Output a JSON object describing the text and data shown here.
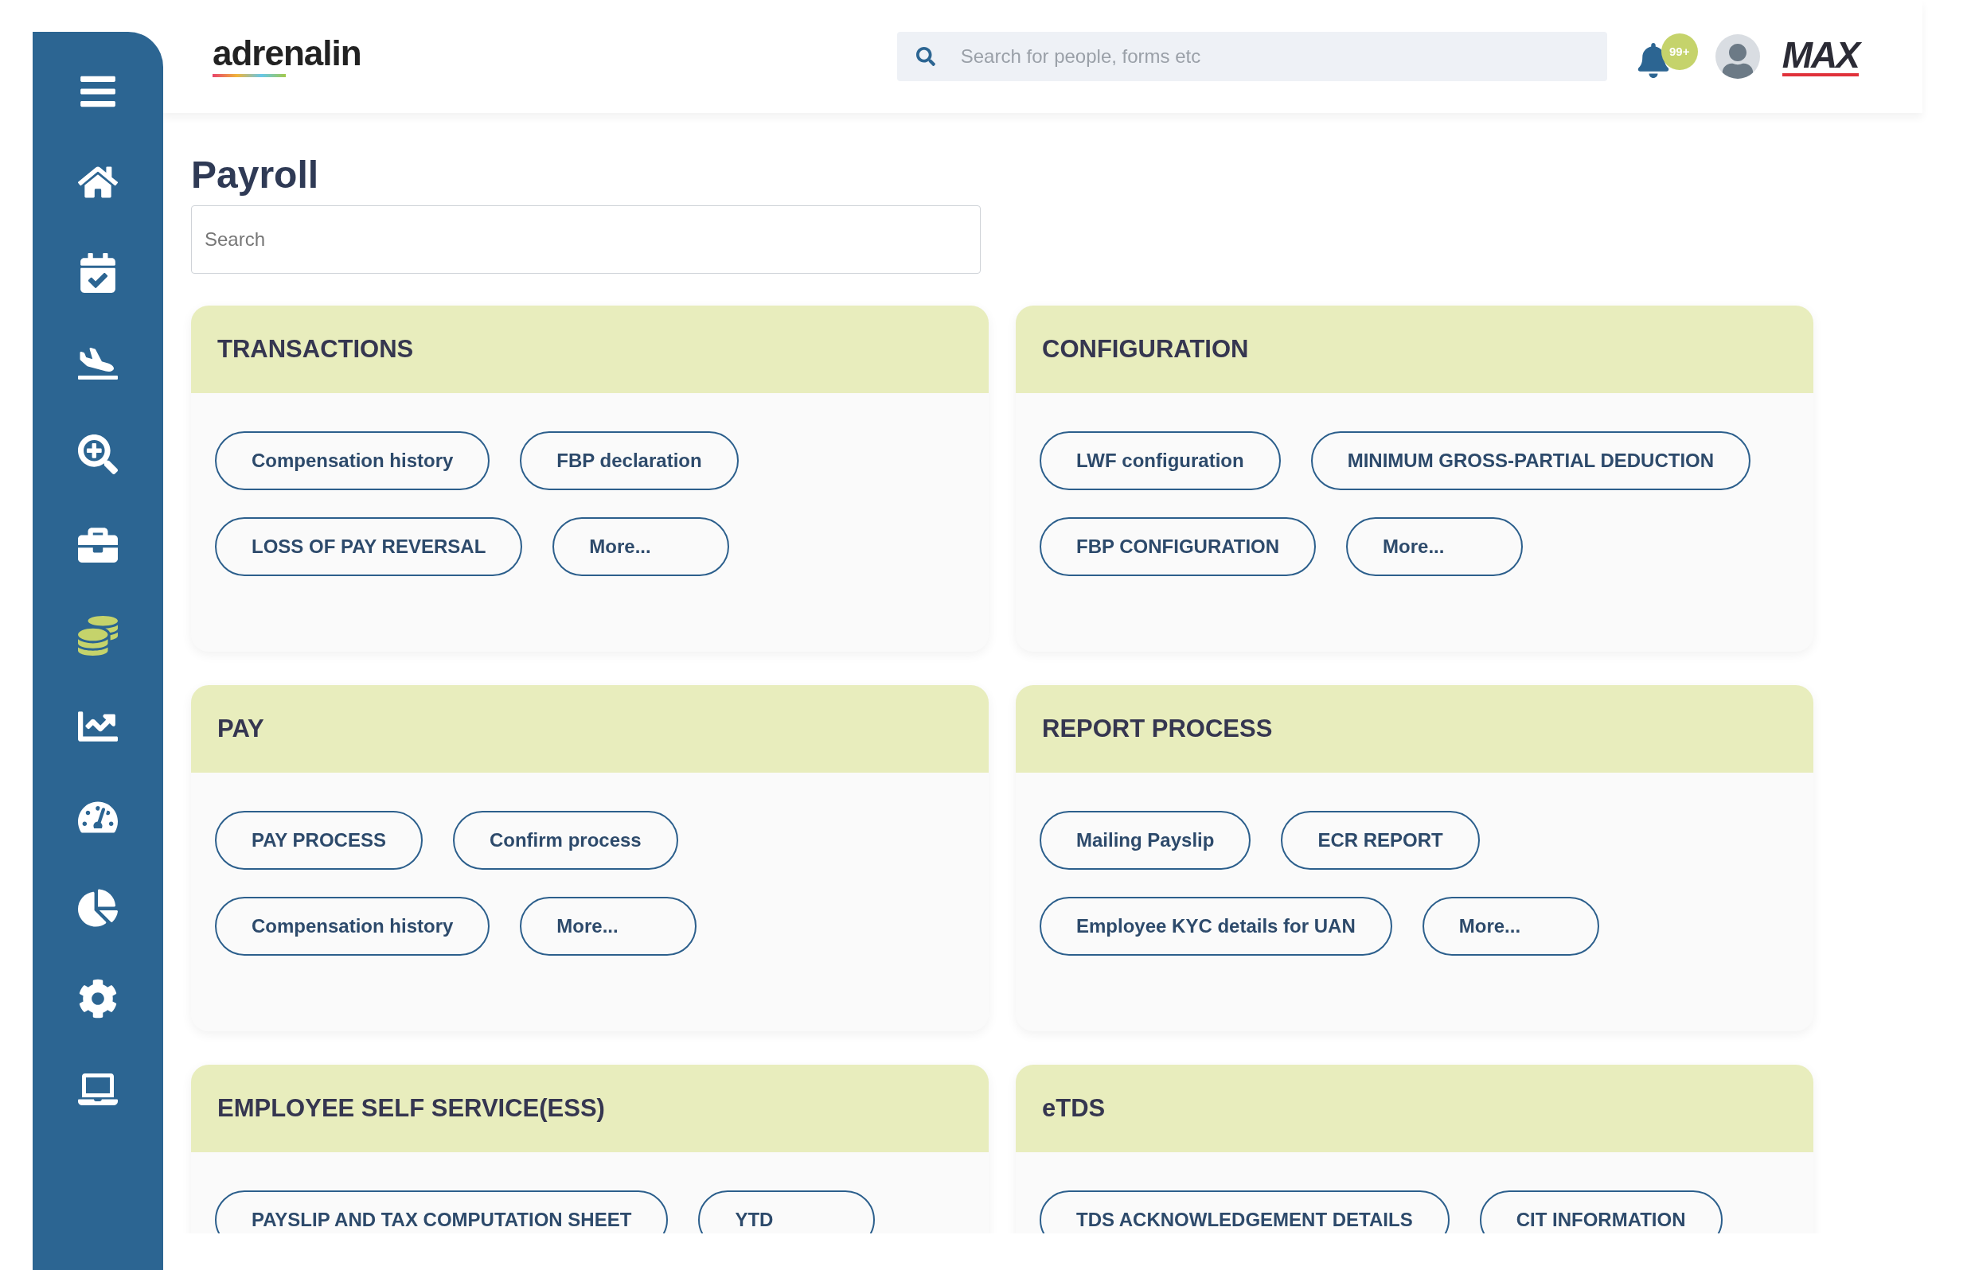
{
  "sidebar": {
    "items": [
      {
        "kind": "menu",
        "selected": false
      },
      {
        "kind": "home",
        "selected": false
      },
      {
        "kind": "calendar",
        "selected": false
      },
      {
        "kind": "plane",
        "selected": false
      },
      {
        "kind": "zoom",
        "selected": false
      },
      {
        "kind": "briefcase",
        "selected": false
      },
      {
        "kind": "coins",
        "selected": true
      },
      {
        "kind": "chart",
        "selected": false
      },
      {
        "kind": "gauge",
        "selected": false
      },
      {
        "kind": "pie",
        "selected": false
      },
      {
        "kind": "settings",
        "selected": false
      },
      {
        "kind": "laptop",
        "selected": false
      }
    ]
  },
  "header": {
    "logo": "adrenalin",
    "search": {
      "placeholder": "Search for people, forms etc"
    },
    "notifications": "99+",
    "brand": "MAX"
  },
  "page": {
    "title": "Payroll",
    "search": {
      "placeholder": "Search"
    }
  },
  "sections": [
    {
      "title": "TRANSACTIONS",
      "links": [
        "Compensation history",
        "FBP declaration",
        "LOSS OF PAY REVERSAL",
        "More..."
      ]
    },
    {
      "title": "CONFIGURATION",
      "links": [
        "LWF configuration",
        "MINIMUM GROSS-PARTIAL DEDUCTION",
        "FBP CONFIGURATION",
        "More..."
      ]
    },
    {
      "title": "PAY",
      "links": [
        "PAY PROCESS",
        "Confirm process",
        "Compensation history",
        "More..."
      ]
    },
    {
      "title": "REPORT PROCESS",
      "links": [
        "Mailing Payslip",
        "ECR REPORT",
        "Employee KYC details for UAN",
        "More..."
      ]
    },
    {
      "title": "EMPLOYEE SELF SERVICE(ESS)",
      "links": [
        "PAYSLIP AND TAX COMPUTATION SHEET",
        "YTD"
      ]
    },
    {
      "title": "eTDS",
      "links": [
        "TDS ACKNOWLEDGEMENT DETAILS",
        "CIT INFORMATION"
      ]
    }
  ]
}
